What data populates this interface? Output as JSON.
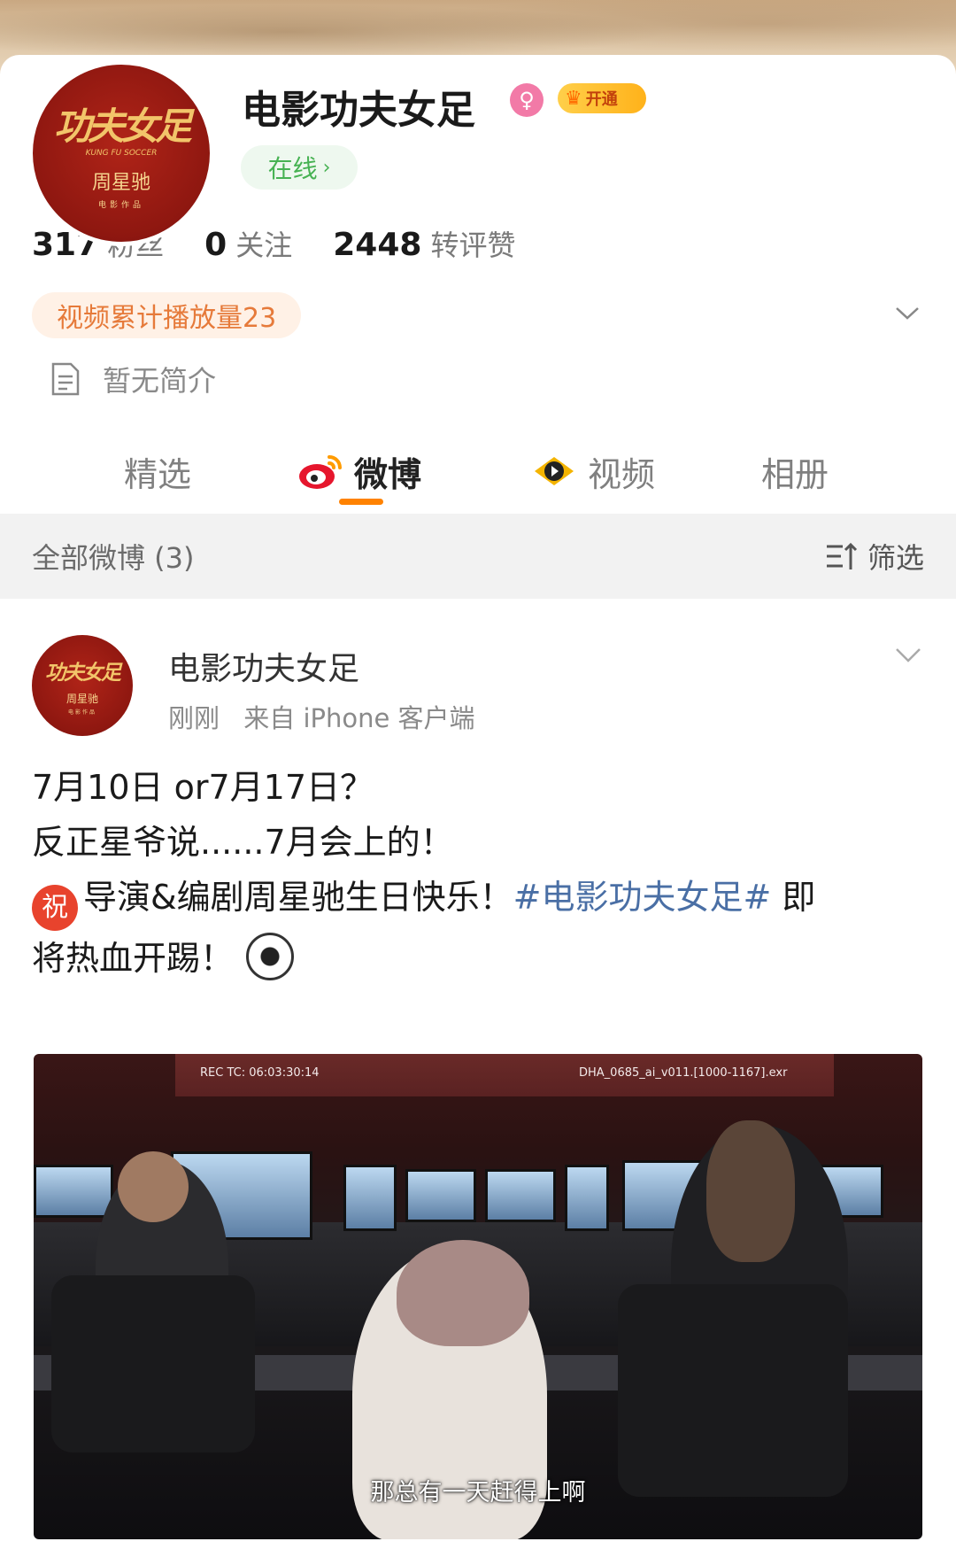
{
  "profile": {
    "name": "电影功夫女足",
    "avatar_logo_cn": "功夫女足",
    "avatar_logo_en": "KUNG FU SOCCER",
    "avatar_director": "周星驰",
    "avatar_sub": "电影作品",
    "vip_label": "开通",
    "online_label": "在线",
    "stats": [
      {
        "num": "317",
        "label": "粉丝"
      },
      {
        "num": "0",
        "label": "关注"
      },
      {
        "num": "2448",
        "label": "转评赞"
      }
    ],
    "play_count": "视频累计播放量23",
    "bio": "暂无简介"
  },
  "tabs": [
    {
      "label": "精选"
    },
    {
      "label": "微博"
    },
    {
      "label": "视频"
    },
    {
      "label": "相册"
    }
  ],
  "filterbar": {
    "title": "全部微博 (3)",
    "filter_label": "筛选"
  },
  "post": {
    "author": "电影功夫女足",
    "time": "刚刚",
    "source": "来自 iPhone 客户端",
    "line1": "7月10日 or7月17日？",
    "line2": "反正星爷说......7月会上的！",
    "zhu": "祝",
    "line3a": "导演&编剧周星驰生日快乐！",
    "hashtag": "#电影功夫女足#",
    "line3b": " 即",
    "line4": "将热血开踢！",
    "media": {
      "timecode": "REC TC: 06:03:30:14",
      "filename": "DHA_0685_ai_v011.[1000-1167].exr",
      "subtitle": "那总有一天赶得上啊"
    }
  },
  "colors": {
    "accent": "#ff8200",
    "hashtag": "#4a6fa5",
    "online_green": "#47b253",
    "playcount": "#e67a3a"
  }
}
